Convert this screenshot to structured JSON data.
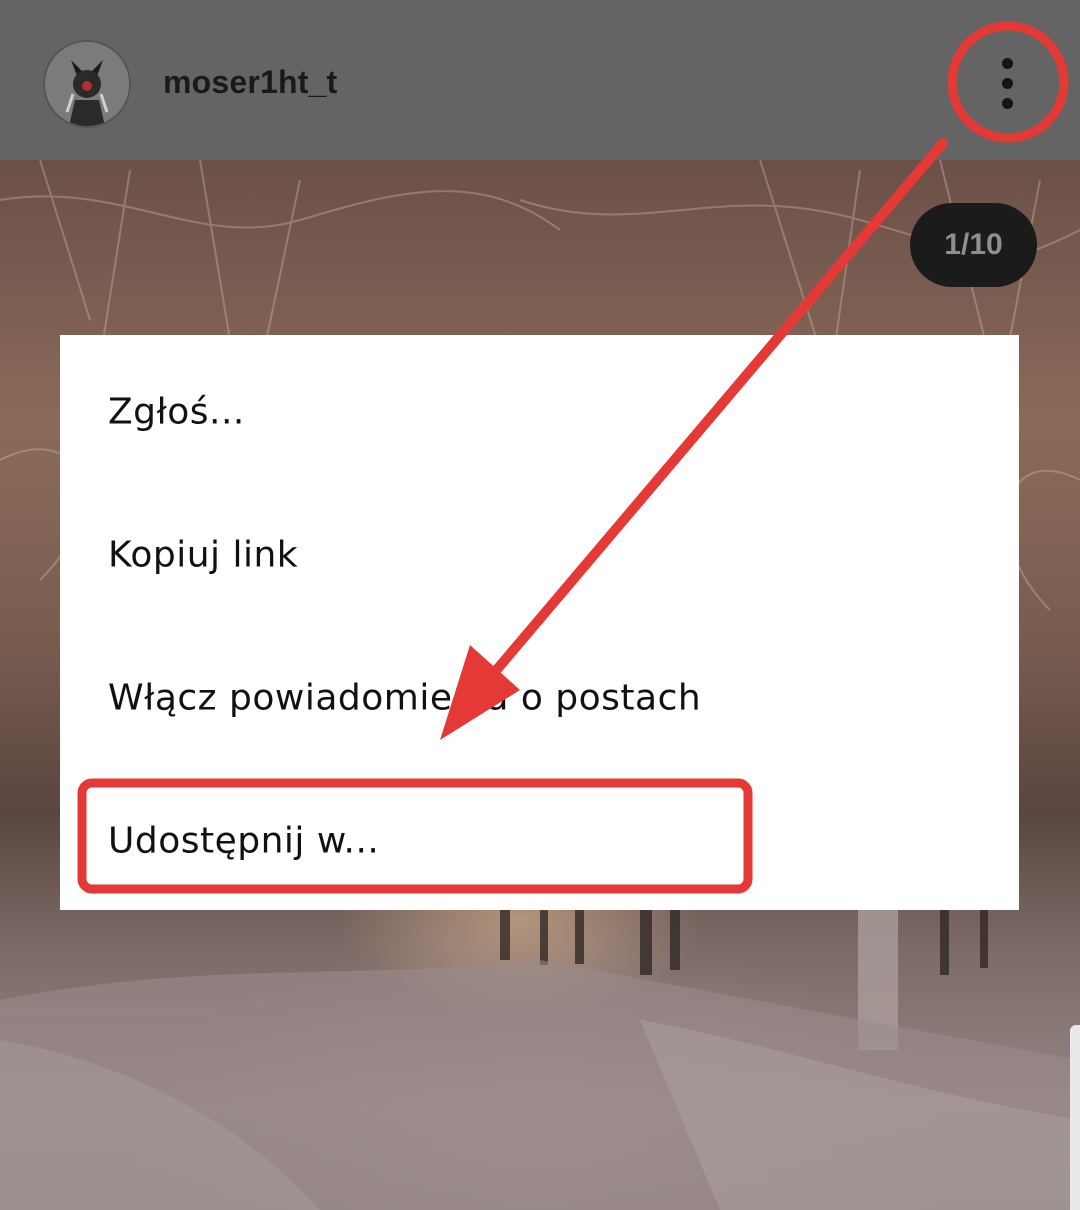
{
  "header": {
    "username": "moser1ht_t",
    "more_icon": "vertical-ellipsis-icon"
  },
  "post": {
    "counter": "1/10"
  },
  "menu": {
    "items": [
      {
        "label": "Zgłoś..."
      },
      {
        "label": "Kopiuj link"
      },
      {
        "label": "Włącz powiadomienia o postach"
      },
      {
        "label": "Udostępnij w..."
      }
    ]
  },
  "colors": {
    "header_bg": "#646464",
    "menu_bg": "#ffffff",
    "annotation_red": "#e53935",
    "counter_bg": "#1b1b1b"
  }
}
